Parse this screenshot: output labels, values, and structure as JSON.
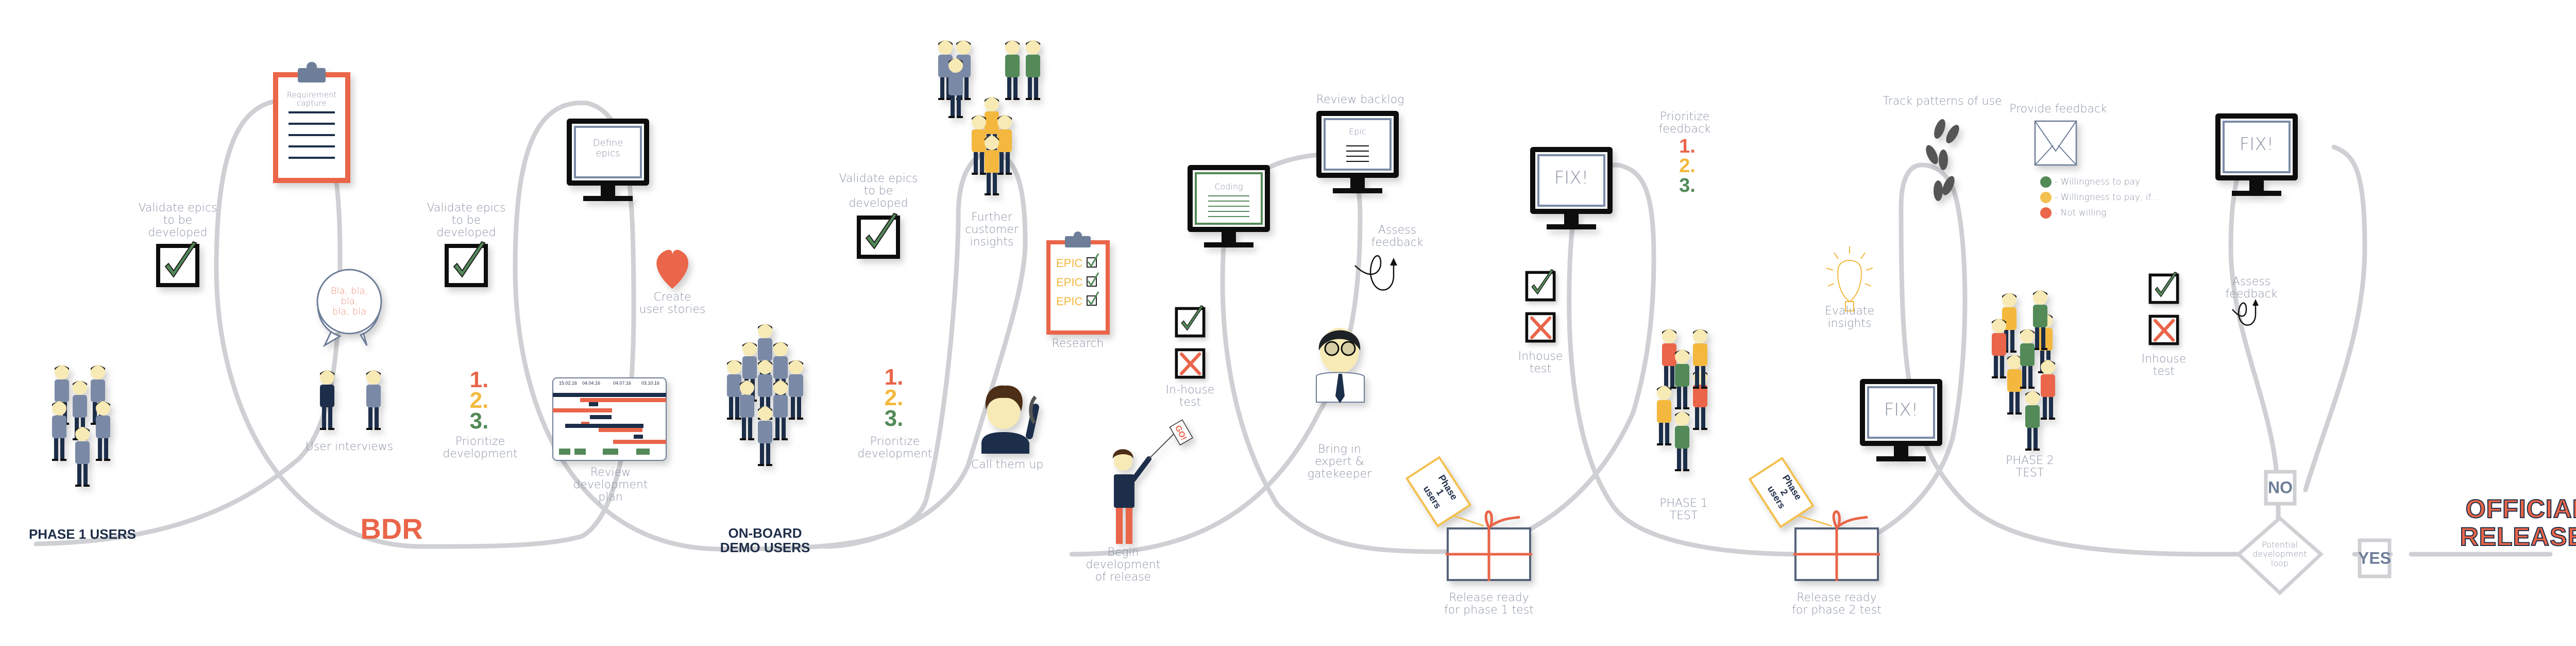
{
  "colors": {
    "path": "#cfd0d3",
    "accent_red": "#ea6549",
    "accent_yellow": "#f3b83c",
    "accent_green": "#528a58",
    "navy": "#1e2d48",
    "slate": "#6e7e99",
    "label_gray": "#8a93a3"
  },
  "sections": {
    "phase1_users": "PHASE 1 USERS",
    "bdr": "BDR",
    "onboard_demo_users": "ON-BOARD\nDEMO USERS",
    "official_release": "OFFICIAL\nRELEASE!"
  },
  "nodes": {
    "requirement_capture": "Requirement\ncapture",
    "validate_epics_1": "Validate epics\nto be\ndeveloped",
    "user_interviews": "User interviews",
    "speech_bubble": "Bla, bla,\nbla,\nbla, bla",
    "validate_epics_2": "Validate epics\nto be\ndeveloped",
    "prioritize_dev_1": "Prioritize\ndevelopment",
    "define_epics": "Define\nepics",
    "create_user_stories": "Create\nuser stories",
    "review_dev_plan": "Review\ndevelopment\nplan",
    "validate_epics_3": "Validate epics\nto be\ndeveloped",
    "further_insights": "Further\ncustomer\ninsights",
    "prioritize_dev_2": "Prioritize\ndevelopment",
    "research": "Research",
    "call_them_up": "Call them up",
    "begin_dev": "Begin\ndevelopment\nof release",
    "inhouse_test_1": "In-house\ntest",
    "coding": "Coding",
    "review_backlog": "Review backlog",
    "epic_screen": "Epic",
    "assess_feedback_1": "Assess\nfeedback",
    "bring_in_expert": "Bring in\nexpert &\ngatekeeper",
    "fix_1": "FIX!",
    "prioritize_feedback": "Prioritize\nfeedback",
    "inhouse_test_2": "Inhouse\ntest",
    "release_ready_1": "Release ready\nfor phase 1 test",
    "phase1_test": "PHASE 1\nTEST",
    "track_patterns": "Track patterns of use",
    "provide_feedback": "Provide feedback",
    "evaluate_insights": "Evaluate\ninsights",
    "fix_2": "FIX!",
    "release_ready_2": "Release ready\nfor phase 2 test",
    "phase2_test": "PHASE 2\nTEST",
    "inhouse_test_3": "Inhouse\ntest",
    "fix_3": "FIX!",
    "assess_feedback_2": "Assess\nfeedback",
    "decision": "Potential\ndevelopment\nloop",
    "no": "NO",
    "yes": "YES"
  },
  "priority_numbers": [
    "1.",
    "2.",
    "3."
  ],
  "epic_items": [
    "EPIC",
    "EPIC",
    "EPIC"
  ],
  "tags": {
    "phase1": "Phase\n1\nusers",
    "phase2": "Phase\n2\nusers"
  },
  "go_flag": "GO!",
  "feedback_legend": [
    {
      "label": "- Willingness to pay",
      "color": "#528a58"
    },
    {
      "label": "- Willingness to pay, if...",
      "color": "#f3c04f"
    },
    {
      "label": "- Not willing",
      "color": "#ea6549"
    }
  ],
  "gantt_dates": [
    "15.02.16",
    "04.04.16",
    "04.07.16",
    "03.10.16"
  ],
  "icons": {
    "clipboard": "clipboard-icon",
    "checkbox_check": "checkbox-check-icon",
    "checkbox_cross": "checkbox-cross-icon",
    "monitor": "monitor-icon",
    "heart": "heart-icon",
    "gantt": "gantt-chart-icon",
    "gift": "gift-box-icon",
    "footprints": "footprints-icon",
    "envelope": "envelope-icon",
    "lightbulb": "lightbulb-icon",
    "loop_arrow": "loop-arrow-icon",
    "people_group": "people-group-icon",
    "person": "person-icon",
    "phone": "telephone-icon",
    "flag": "flag-icon"
  }
}
